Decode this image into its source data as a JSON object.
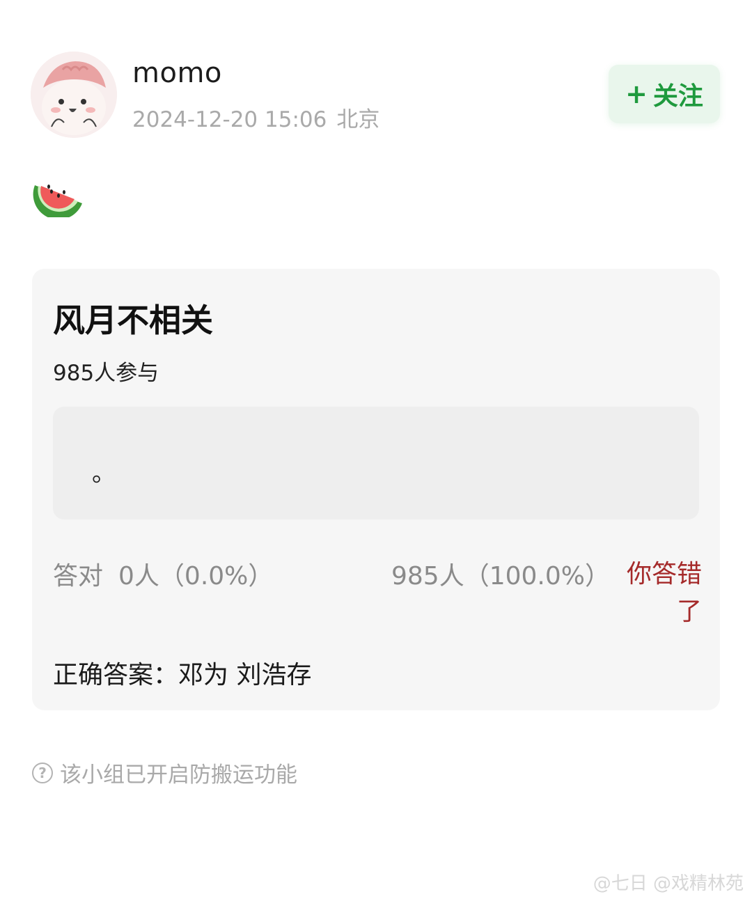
{
  "post": {
    "username": "momo",
    "timestamp": "2024-12-20 15:06",
    "location": "北京",
    "follow_plus": "+",
    "follow_label": "关注",
    "emoji_icon": "watermelon-icon"
  },
  "quiz": {
    "title": "风月不相关",
    "participants": "985人参与",
    "answer_text": "。",
    "correct_label": "答对",
    "correct_stat": "0人（0.0%）",
    "wrong_stat": "985人（100.0%）",
    "result": "你答错了",
    "correct_answer": "正确答案：邓为 刘浩存"
  },
  "footer": {
    "notice": "该小组已开启防搬运功能",
    "help_icon": "question-circle-icon"
  },
  "watermark": "@七日  @戏精林苑",
  "colors": {
    "accent_green": "#1f9a3e",
    "follow_bg": "#e9f6ec",
    "wrong_red": "#a52a2a",
    "card_bg": "#f6f6f6"
  }
}
